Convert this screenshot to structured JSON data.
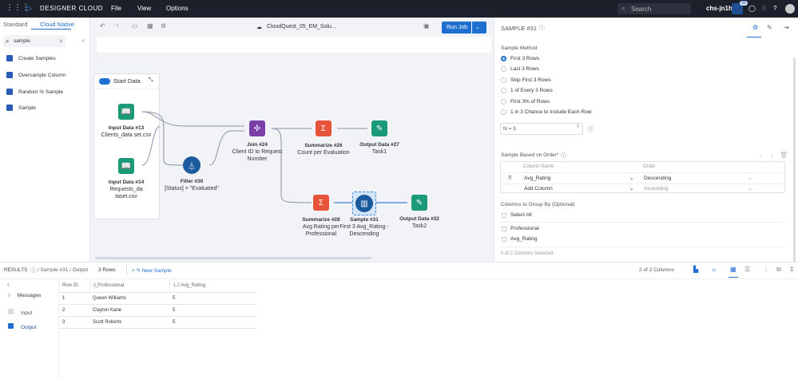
{
  "topbar": {
    "brand": "DESIGNER CLOUD",
    "menus": [
      "File",
      "View",
      "Options"
    ],
    "search_placeholder": "Search",
    "workspace": "chs-jn1h",
    "badge": "30"
  },
  "left": {
    "tabs": [
      "Standard",
      "Cloud Native"
    ],
    "search_value": "sample",
    "tools": [
      "Create Samples",
      "Oversample Column",
      "Random % Sample",
      "Sample"
    ]
  },
  "canvas": {
    "workflow_name": "CloudQuest_05_EM_Solu...",
    "run_label": "Run Job",
    "container_label": "Start Data",
    "nodes": [
      {
        "title": "Input Data #13",
        "sub": "Clients_data set.csv"
      },
      {
        "title": "Input Data #14",
        "sub": "Requests_da taset.csv"
      },
      {
        "title": "Filter #30",
        "sub": "[Status] = \"Evaluated\""
      },
      {
        "title": "Join #24",
        "sub": "Client ID to Request Number"
      },
      {
        "title": "Summarize #26",
        "sub": "Count per Evaluation"
      },
      {
        "title": "Output Data #27",
        "sub": "Task1"
      },
      {
        "title": "Summarize #28",
        "sub": "Avg Rating per Professional"
      },
      {
        "title": "Sample #31",
        "sub": "First 3 Avg_Rating - Descending"
      },
      {
        "title": "Output Data #32",
        "sub": "Task2"
      }
    ]
  },
  "panel": {
    "title": "SAMPLE #31",
    "method_label": "Sample Method",
    "methods": [
      "First 3 Rows",
      "Last 3 Rows",
      "Skip First 3 Rows",
      "1 of Every 3 Rows",
      "First 3% of Rows",
      "1 in 3 Chance to Include Each Row"
    ],
    "selected": 0,
    "n_value": "N = 3",
    "order_label": "Sample Based on Order*",
    "col_header": "Column Name",
    "order_header": "Order",
    "rows": [
      {
        "col": "Avg_Rating",
        "order": "Descending"
      },
      {
        "col": "Add Column",
        "order": "Ascending"
      }
    ],
    "group_label": "Columns to Group By (Optional)",
    "select_all": "Select All",
    "group_cols": [
      "Professional",
      "Avg_Rating"
    ],
    "selected_count": "0 of 2 Columns Selected"
  },
  "results": {
    "label": "RESULTS",
    "path": "/ Sample #31 / Output",
    "rows_count": "3 Rows",
    "new_sample": "New Sample",
    "columns_count": "2 of 2 Columns",
    "nav": [
      {
        "label": "Messages",
        "count": "0"
      },
      {
        "label": "Input"
      },
      {
        "label": "Output"
      }
    ],
    "headers": [
      "Row ID",
      "Professional",
      "Avg_Rating"
    ],
    "data": [
      [
        "1",
        "Queen Williams",
        "5"
      ],
      [
        "2",
        "Clayton Kane",
        "5"
      ],
      [
        "3",
        "Scott Roberts",
        "5"
      ]
    ]
  }
}
